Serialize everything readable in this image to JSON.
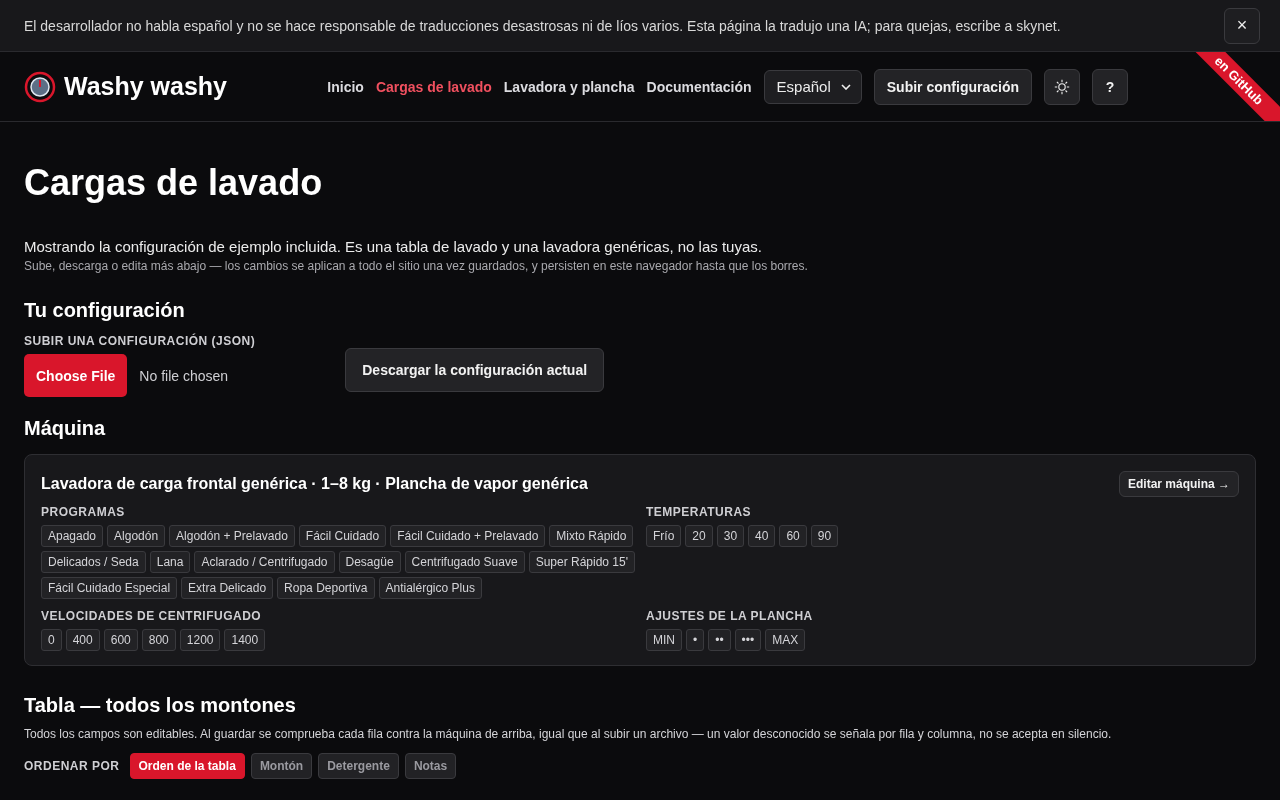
{
  "notice": {
    "text": "El desarrollador no habla español y no se hace responsable de traducciones desastrosas ni de líos varios. Esta página la tradujo una IA; para quejas, escribe a skynet.",
    "close": "×"
  },
  "header": {
    "brand": "Washy washy",
    "nav": [
      {
        "label": "Inicio",
        "selected": false
      },
      {
        "label": "Cargas de lavado",
        "selected": true
      },
      {
        "label": "Lavadora y plancha",
        "selected": false
      },
      {
        "label": "Documentación",
        "selected": false
      }
    ],
    "language": "Español",
    "upload_button": "Subir configuración",
    "help_button": "?",
    "ribbon": "en GitHub"
  },
  "page": {
    "title": "Cargas de lavado",
    "intro": "Mostrando la configuración de ejemplo incluida. Es una tabla de lavado y una lavadora genéricas, no las tuyas.",
    "hint": "Sube, descarga o edita más abajo — los cambios se aplican a todo el sitio una vez guardados, y persisten en este navegador hasta que los borres."
  },
  "config": {
    "title": "Tu configuración",
    "upload_label": "SUBIR UNA CONFIGURACIÓN (JSON)",
    "file_button": "Choose File",
    "file_status": "No file chosen",
    "download_button": "Descargar la configuración actual"
  },
  "machine": {
    "title": "Máquina",
    "card_title": "Lavadora de carga frontal genérica · 1–8 kg · Plancha de vapor genérica",
    "edit_button": "Editar máquina →",
    "groups": [
      {
        "label": "PROGRAMAS",
        "items": [
          "Apagado",
          "Algodón",
          "Algodón + Prelavado",
          "Fácil Cuidado",
          "Fácil Cuidado + Prelavado",
          "Mixto Rápido",
          "Delicados / Seda",
          "Lana",
          "Aclarado / Centrifugado",
          "Desagüe",
          "Centrifugado Suave",
          "Super Rápido 15'",
          "Fácil Cuidado Especial",
          "Extra Delicado",
          "Ropa Deportiva",
          "Antialérgico Plus"
        ]
      },
      {
        "label": "TEMPERATURAS",
        "items": [
          "Frío",
          "20",
          "30",
          "40",
          "60",
          "90"
        ]
      },
      {
        "label": "VELOCIDADES DE CENTRIFUGADO",
        "items": [
          "0",
          "400",
          "600",
          "800",
          "1200",
          "1400"
        ]
      },
      {
        "label": "AJUSTES DE LA PLANCHA",
        "items": [
          "MIN",
          "•",
          "••",
          "•••",
          "MAX"
        ]
      }
    ]
  },
  "table": {
    "title": "Tabla — todos los montones",
    "description": "Todos los campos son editables. Al guardar se comprueba cada fila contra la máquina de arriba, igual que al subir un archivo — un valor desconocido se señala por fila y columna, no se acepta en silencio.",
    "sort_label": "ORDENAR POR",
    "sort_options": [
      {
        "label": "Orden de la tabla",
        "selected": true
      },
      {
        "label": "Montón",
        "selected": false
      },
      {
        "label": "Detergente",
        "selected": false
      },
      {
        "label": "Notas",
        "selected": false
      }
    ]
  }
}
